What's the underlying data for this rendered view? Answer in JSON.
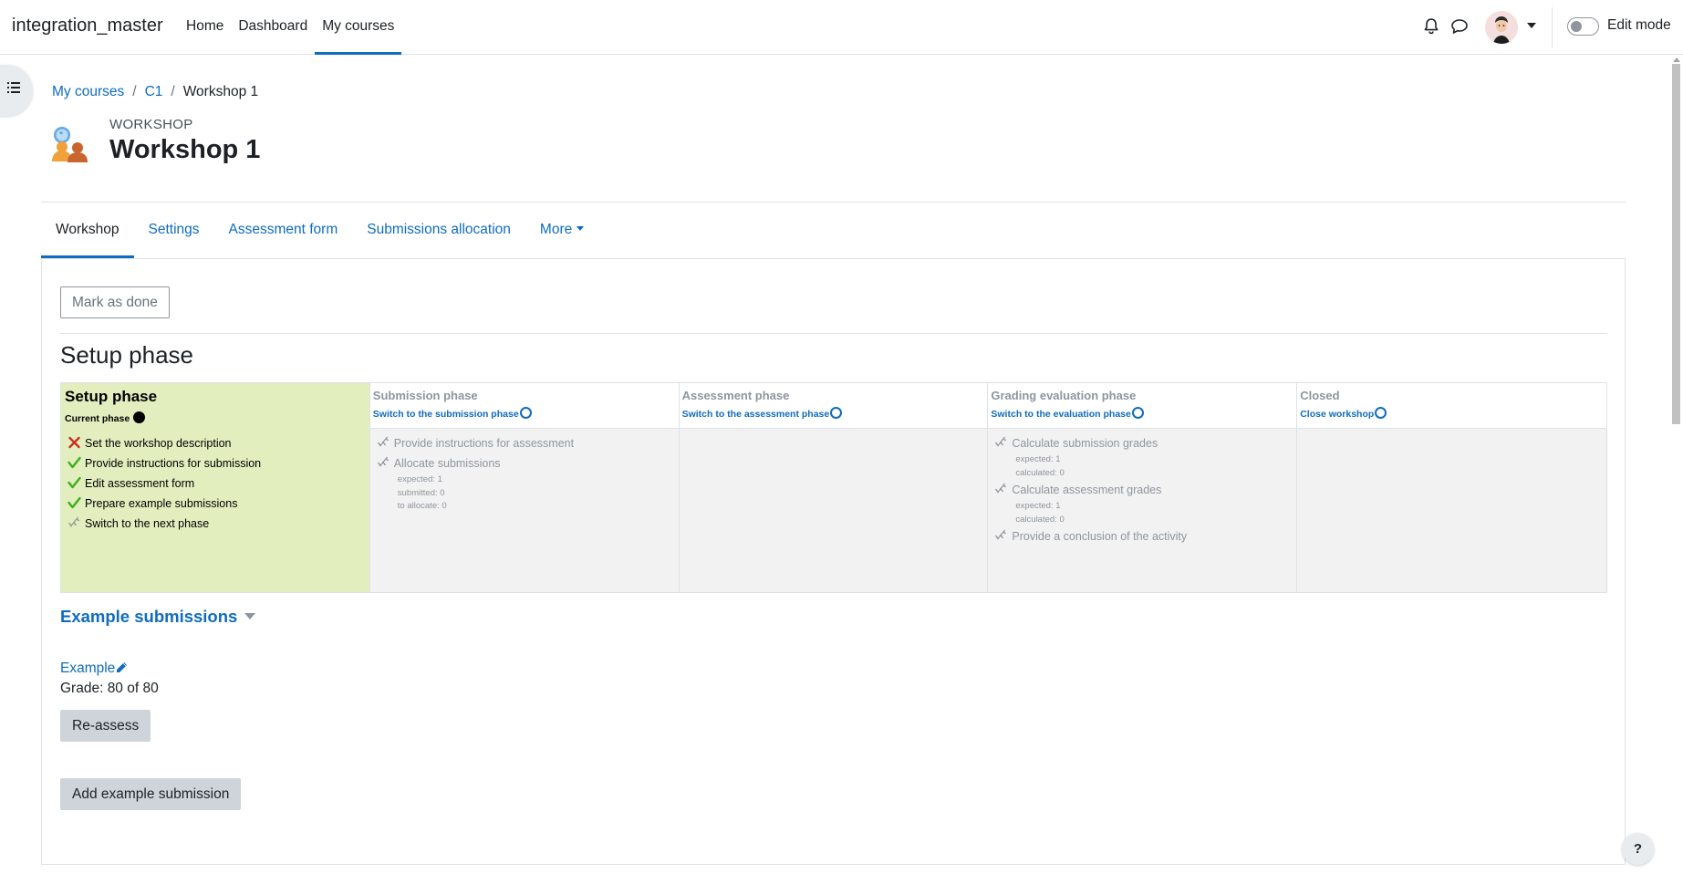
{
  "navbar": {
    "brand": "integration_master",
    "links": [
      "Home",
      "Dashboard",
      "My courses"
    ],
    "active_link": "My courses",
    "edit_mode_label": "Edit mode"
  },
  "breadcrumb": {
    "items": [
      "My courses",
      "C1"
    ],
    "current": "Workshop 1",
    "separator": "/"
  },
  "header": {
    "activity_type": "WORKSHOP",
    "title": "Workshop 1"
  },
  "secondary_nav": {
    "tabs": [
      "Workshop",
      "Settings",
      "Assessment form",
      "Submissions allocation",
      "More"
    ],
    "active_tab": "Workshop"
  },
  "main": {
    "mark_done_label": "Mark as done",
    "section_title": "Setup phase"
  },
  "phases": [
    {
      "name": "Setup phase",
      "current_label": "Current phase",
      "tasks": [
        {
          "label": "Set the workshop description",
          "status": "fail"
        },
        {
          "label": "Provide instructions for submission",
          "status": "done"
        },
        {
          "label": "Edit assessment form",
          "status": "done"
        },
        {
          "label": "Prepare example submissions",
          "status": "done"
        },
        {
          "label": "Switch to the next phase",
          "status": "todo"
        }
      ]
    },
    {
      "name": "Submission phase",
      "action": "Switch to the submission phase",
      "tasks": [
        {
          "label": "Provide instructions for assessment",
          "details": []
        },
        {
          "label": "Allocate submissions",
          "details": [
            "expected: 1",
            "submitted: 0",
            "to allocate: 0"
          ]
        }
      ]
    },
    {
      "name": "Assessment phase",
      "action": "Switch to the assessment phase",
      "tasks": []
    },
    {
      "name": "Grading evaluation phase",
      "action": "Switch to the evaluation phase",
      "tasks": [
        {
          "label": "Calculate submission grades",
          "details": [
            "expected: 1",
            "calculated: 0"
          ]
        },
        {
          "label": "Calculate assessment grades",
          "details": [
            "expected: 1",
            "calculated: 0"
          ]
        },
        {
          "label": "Provide a conclusion of the activity",
          "details": []
        }
      ]
    },
    {
      "name": "Closed",
      "action": "Close workshop",
      "tasks": []
    }
  ],
  "examples": {
    "heading": "Example submissions",
    "item_title": "Example",
    "grade_text": "Grade: 80 of 80",
    "reassess_label": "Re-assess",
    "add_label": "Add example submission"
  },
  "help": {
    "label": "?"
  },
  "colors": {
    "accent": "#0f6cbf",
    "current_phase_bg": "#e2eebe",
    "fail": "#ca3120",
    "done": "#3eaf1a"
  }
}
